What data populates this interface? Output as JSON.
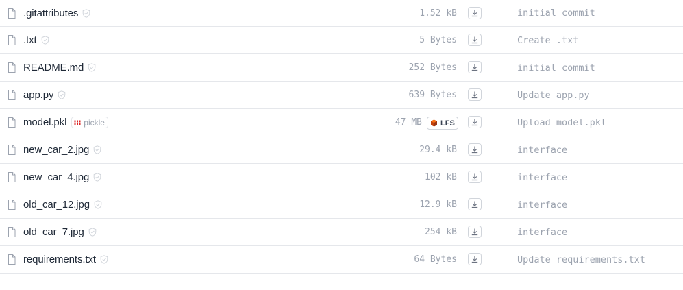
{
  "files": [
    {
      "name": ".gitattributes",
      "size": "1.52 kB",
      "commit": "initial commit",
      "safe": true
    },
    {
      "name": ".txt",
      "size": "5 Bytes",
      "commit": "Create .txt",
      "safe": true
    },
    {
      "name": "README.md",
      "size": "252 Bytes",
      "commit": "initial commit",
      "safe": true
    },
    {
      "name": "app.py",
      "size": "639 Bytes",
      "commit": "Update app.py",
      "safe": true
    },
    {
      "name": "model.pkl",
      "size": "47 MB",
      "commit": "Upload model.pkl",
      "safe": false,
      "badge": "pickle",
      "lfs": "LFS"
    },
    {
      "name": "new_car_2.jpg",
      "size": "29.4 kB",
      "commit": "interface",
      "safe": true
    },
    {
      "name": "new_car_4.jpg",
      "size": "102 kB",
      "commit": "interface",
      "safe": true
    },
    {
      "name": "old_car_12.jpg",
      "size": "12.9 kB",
      "commit": "interface",
      "safe": true
    },
    {
      "name": "old_car_7.jpg",
      "size": "254 kB",
      "commit": "interface",
      "safe": true
    },
    {
      "name": "requirements.txt",
      "size": "64 Bytes",
      "commit": "Update requirements.txt",
      "safe": true
    }
  ],
  "icons": {
    "file": "file-icon",
    "safe": "shield-check-icon",
    "pickle": "pickle-icon",
    "lfs": "lfs-cube-icon",
    "download": "download-icon"
  },
  "colors": {
    "text": "#1f2937",
    "muted": "#9ca3af",
    "border": "#e5e7eb",
    "pickle_icon": "#dc2626",
    "lfs_icon": "#b45309"
  }
}
